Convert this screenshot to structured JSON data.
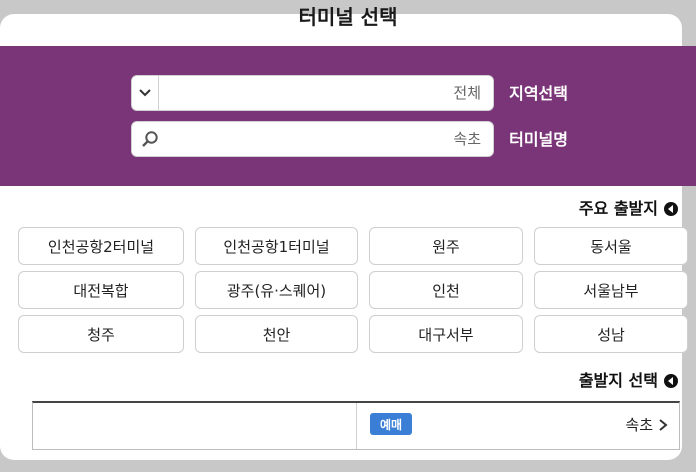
{
  "title": "터미널 선택",
  "search": {
    "region_label": "지역선택",
    "region_value": "전체",
    "terminal_label": "터미널명",
    "terminal_value": "속초"
  },
  "main_departures": {
    "heading": "주요 출발지",
    "terminals": [
      [
        "인천공항2터미널",
        "인천공항1터미널",
        "원주",
        "동서울"
      ],
      [
        "대전복합",
        "광주(유·스퀘어)",
        "인천",
        "서울남부"
      ],
      [
        "청주",
        "천안",
        "대구서부",
        "성남"
      ]
    ]
  },
  "departure_select": {
    "heading": "출발지 선택",
    "results": [
      {
        "name": "속초",
        "badge": "예매"
      }
    ]
  },
  "colors": {
    "panel_bg": "#7a3478",
    "badge_bg": "#3a7fd5"
  }
}
